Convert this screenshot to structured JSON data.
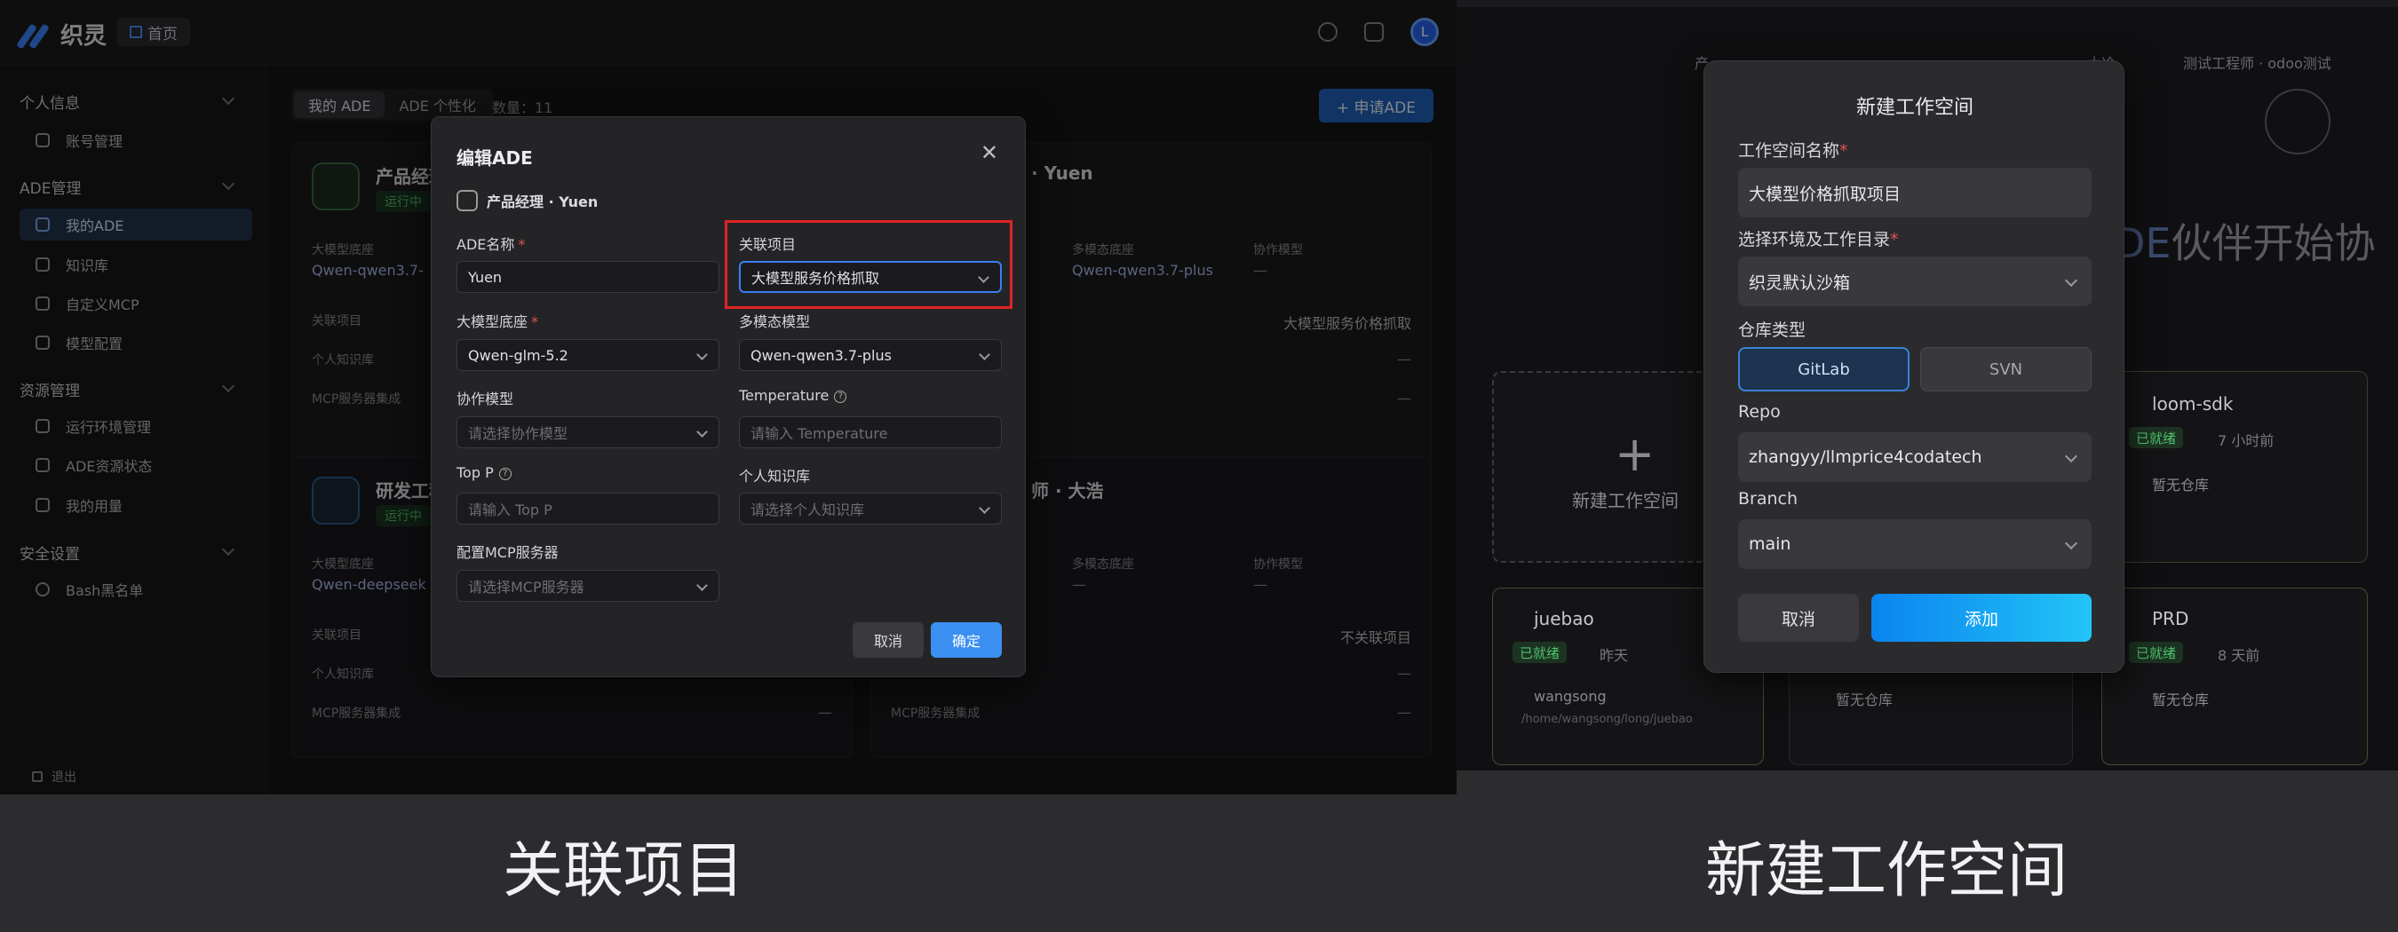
{
  "left": {
    "brand": "织灵",
    "home_chip": "首页",
    "avatar_letter": "L",
    "sidebar": {
      "groups": [
        {
          "label": "个人信息",
          "items": [
            {
              "label": "账号管理"
            }
          ]
        },
        {
          "label": "ADE管理",
          "items": [
            {
              "label": "我的ADE",
              "active": true
            },
            {
              "label": "知识库"
            },
            {
              "label": "自定义MCP"
            },
            {
              "label": "模型配置"
            }
          ]
        },
        {
          "label": "资源管理",
          "items": [
            {
              "label": "运行环境管理"
            },
            {
              "label": "ADE资源状态"
            },
            {
              "label": "我的用量"
            }
          ]
        },
        {
          "label": "安全设置",
          "items": [
            {
              "label": "Bash黑名单"
            }
          ]
        }
      ],
      "logout": "退出"
    },
    "main": {
      "tabs": [
        "我的 ADE",
        "ADE 个性化"
      ],
      "count_label": "数量：11",
      "apply_button": "+ 申请ADE",
      "cards": [
        {
          "title": "产品经理",
          "status": "运行中",
          "model_label": "大模型底座",
          "model": "Qwen-qwen3.7-",
          "project_label": "关联项目",
          "kb_label": "个人知识库",
          "mcp_label": "MCP服务器集成"
        },
        {
          "title": "· Yuen",
          "multimodal_label": "多模态底座",
          "multimodal": "Qwen-qwen3.7-plus",
          "collab_label": "协作模型",
          "collab": "—",
          "project": "大模型服务价格抓取",
          "kb": "—",
          "mcp": "—"
        },
        {
          "title": "研发工程",
          "status": "运行中",
          "model_label": "大模型底座",
          "model": "Qwen-deepseek",
          "project_label": "关联项目",
          "kb_label": "个人知识库",
          "mcp_label": "MCP服务器集成",
          "mcp": "—"
        },
        {
          "title": "师 · 大浩",
          "multimodal_label": "多模态底座",
          "multimodal": "—",
          "collab_label": "协作模型",
          "collab": "—",
          "project": "不关联项目",
          "kb": "—",
          "mcp_label": "MCP服务器集成",
          "mcp": "—"
        }
      ]
    },
    "edit_modal": {
      "title": "编辑ADE",
      "close": "✕",
      "subtitle": "产品经理 · Yuen",
      "fields": {
        "name_label": "ADE名称",
        "name_value": "Yuen",
        "project_label": "关联项目",
        "project_value": "大模型服务价格抓取",
        "base_label": "大模型底座",
        "base_value": "Qwen-glm-5.2",
        "multimodal_label": "多模态模型",
        "multimodal_value": "Qwen-qwen3.7-plus",
        "collab_label": "协作模型",
        "collab_placeholder": "请选择协作模型",
        "temperature_label": "Temperature",
        "temperature_placeholder": "请输入 Temperature",
        "topp_label": "Top P",
        "topp_placeholder": "请输入 Top P",
        "kb_label": "个人知识库",
        "kb_placeholder": "请选择个人知识库",
        "mcp_label": "配置MCP服务器",
        "mcp_placeholder": "请选择MCP服务器"
      },
      "cancel": "取消",
      "ok": "确定"
    }
  },
  "right": {
    "chips": [
      "产",
      "· 太冷",
      "测试工程师 · odoo测试"
    ],
    "big_text_ade": "DE",
    "big_text_rest": "伙伴开始协",
    "new_card_label": "新建工作空间",
    "projects": [
      {
        "name": "loom-sdk",
        "status": "已就绪",
        "time": "7 小时前",
        "repo": "暂无仓库"
      },
      {
        "name": "juebao",
        "status": "已就绪",
        "time": "昨天",
        "user": "wangsong",
        "path": "/home/wangsong/long/juebao"
      },
      {
        "name": "PRD",
        "status": "已就绪",
        "time": "8 天前",
        "repo": "暂无仓库"
      },
      {
        "repo": "暂无仓库"
      }
    ],
    "dialog": {
      "title": "新建工作空间",
      "ws_name_label": "工作空间名称",
      "ws_name_value": "大模型价格抓取项目",
      "env_label": "选择环境及工作目录",
      "env_value": "织灵默认沙箱",
      "repo_type_label": "仓库类型",
      "repo_types": [
        "GitLab",
        "SVN"
      ],
      "repo_label": "Repo",
      "repo_value": "zhangyy/llmprice4codatech",
      "branch_label": "Branch",
      "branch_value": "main",
      "cancel": "取消",
      "add": "添加"
    }
  },
  "captions": {
    "left": "关联项目",
    "right": "新建工作空间"
  }
}
